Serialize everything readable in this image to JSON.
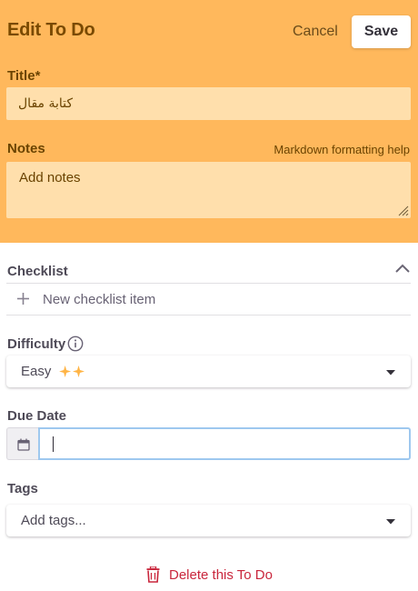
{
  "header": {
    "title": "Edit To Do",
    "cancel_label": "Cancel",
    "save_label": "Save"
  },
  "title_field": {
    "label": "Title*",
    "value": "كتابة مقال"
  },
  "notes_field": {
    "label": "Notes",
    "help_link": "Markdown formatting help",
    "placeholder": "Add notes"
  },
  "checklist": {
    "label": "Checklist",
    "new_item_label": "New checklist item"
  },
  "difficulty": {
    "label": "Difficulty",
    "selected": "Easy"
  },
  "due_date": {
    "label": "Due Date",
    "value": ""
  },
  "tags": {
    "label": "Tags",
    "placeholder": "Add tags..."
  },
  "delete": {
    "label": "Delete this To Do"
  },
  "colors": {
    "header_bg": "#ffb85c",
    "input_bg": "#ffdfac",
    "danger": "#c9263c",
    "focus_border": "#9ec8ef",
    "sparkle": "#ffb445"
  },
  "icons": {
    "collapse": "chevron-up-icon",
    "add": "plus-icon",
    "info": "info-icon",
    "difficulty": "sparkle-icon",
    "dropdown": "caret-down-icon",
    "calendar": "calendar-icon",
    "delete": "trash-icon"
  }
}
